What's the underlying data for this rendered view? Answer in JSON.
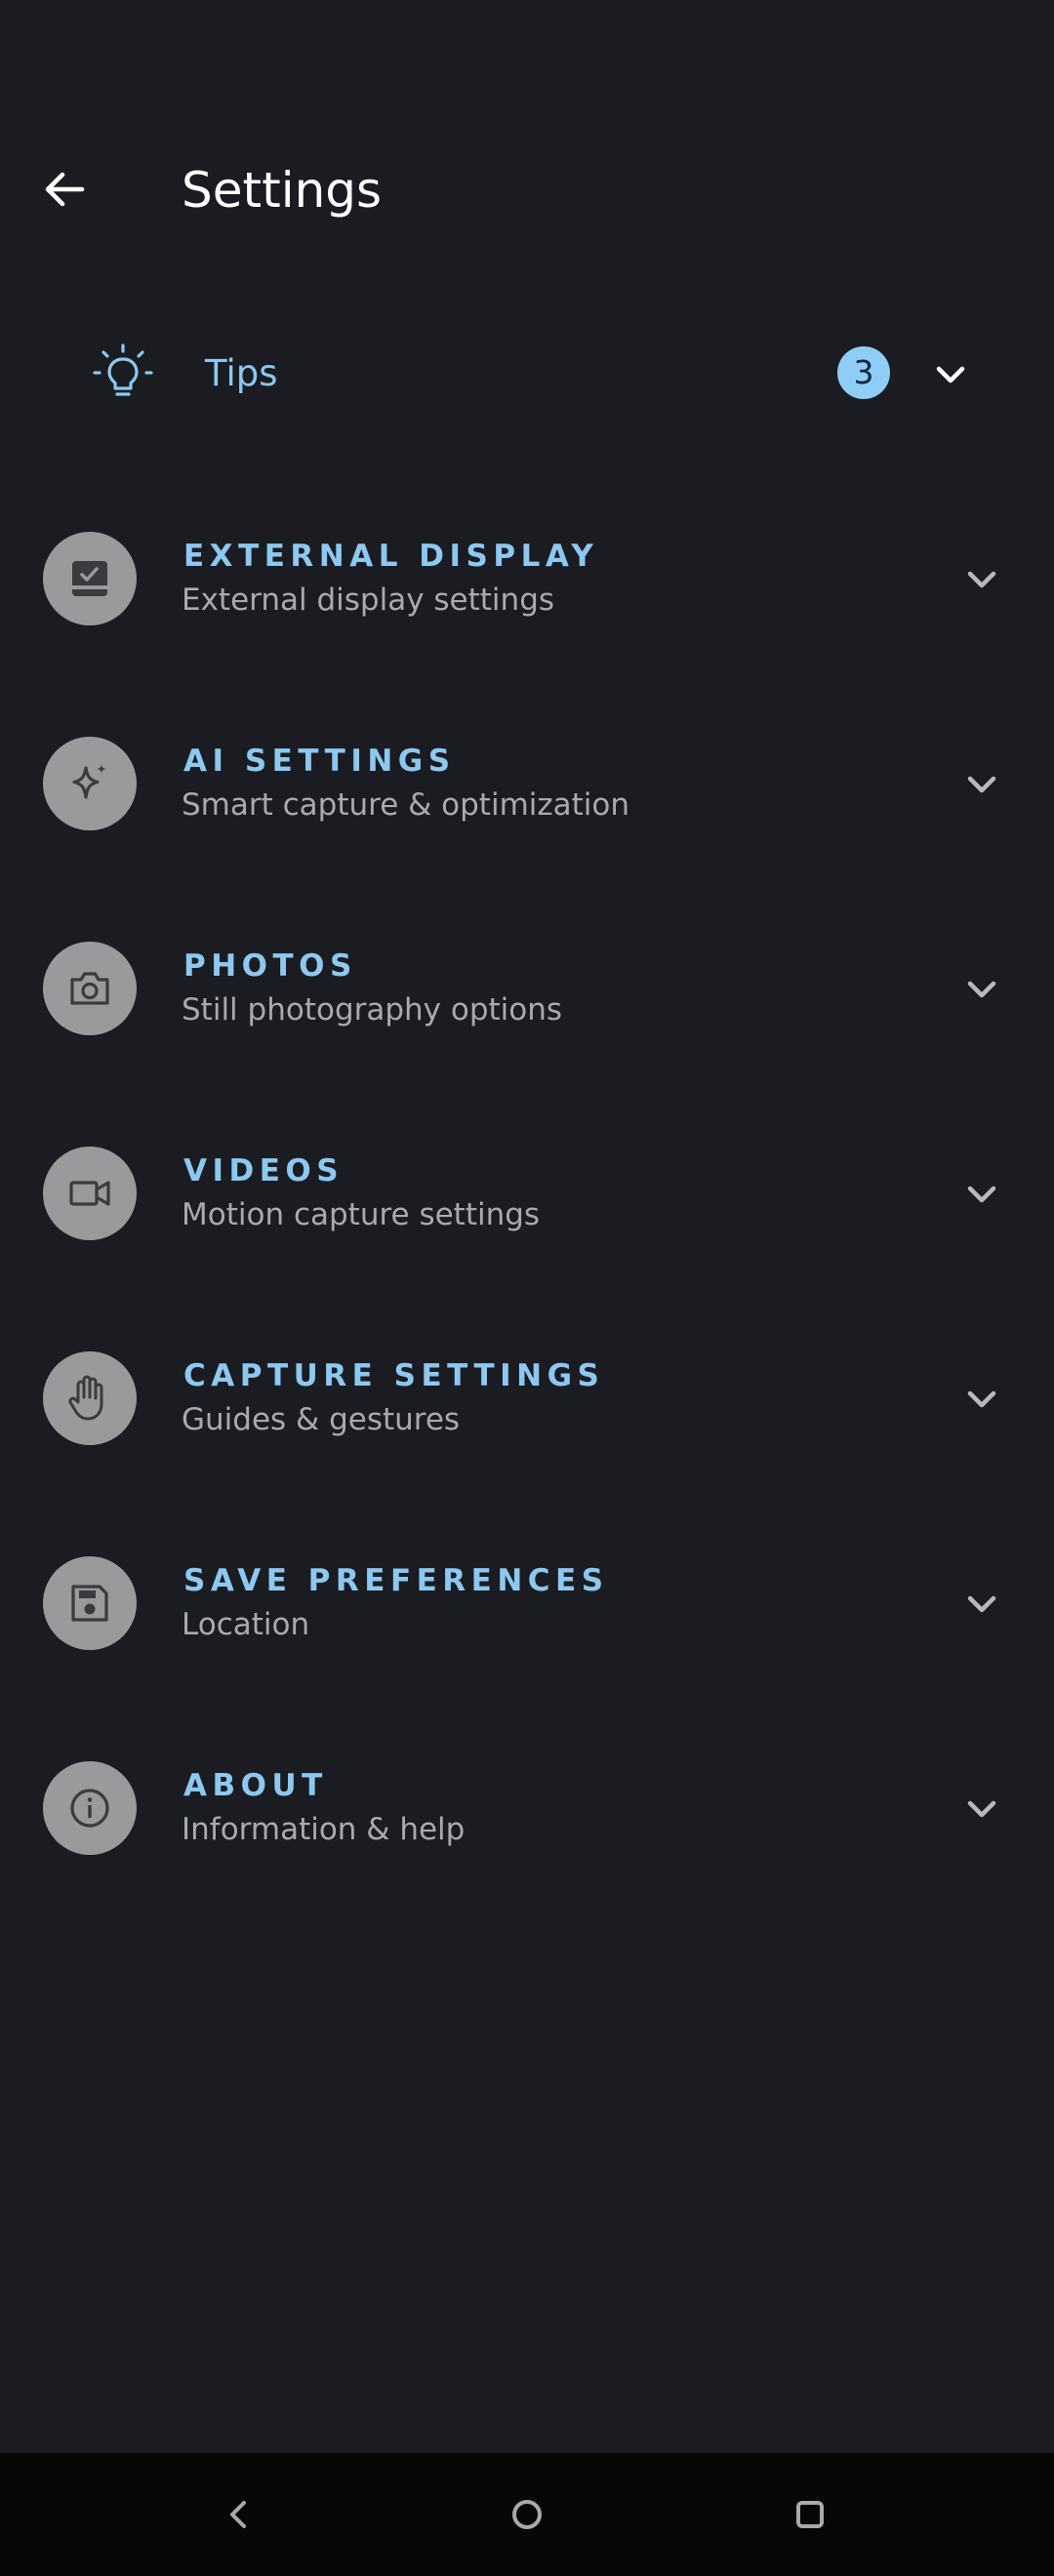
{
  "header": {
    "title": "Settings",
    "back_icon": "arrow-left-icon"
  },
  "tips": {
    "label": "Tips",
    "badge_count": "3",
    "icon": "lightbulb-icon"
  },
  "colors": {
    "background": "#1a1c21",
    "accent": "#8cc8f0",
    "subtitle": "#a8aaad",
    "icon_circle": "#9a9a9c",
    "nav_bar": "#070708"
  },
  "sections": [
    {
      "title": "EXTERNAL DISPLAY",
      "subtitle": "External display settings",
      "icon": "display-check-icon"
    },
    {
      "title": "AI SETTINGS",
      "subtitle": "Smart capture & optimization",
      "icon": "sparkle-icon"
    },
    {
      "title": "PHOTOS",
      "subtitle": "Still photography options",
      "icon": "camera-icon"
    },
    {
      "title": "VIDEOS",
      "subtitle": "Motion capture settings",
      "icon": "video-camera-icon"
    },
    {
      "title": "CAPTURE SETTINGS",
      "subtitle": "Guides & gestures",
      "icon": "hand-icon"
    },
    {
      "title": "SAVE PREFERENCES",
      "subtitle": "Location",
      "icon": "floppy-disk-icon"
    },
    {
      "title": "ABOUT",
      "subtitle": "Information & help",
      "icon": "info-icon"
    }
  ],
  "nav": {
    "back_icon": "nav-back-icon",
    "home_icon": "nav-home-icon",
    "recents_icon": "nav-recents-icon"
  }
}
